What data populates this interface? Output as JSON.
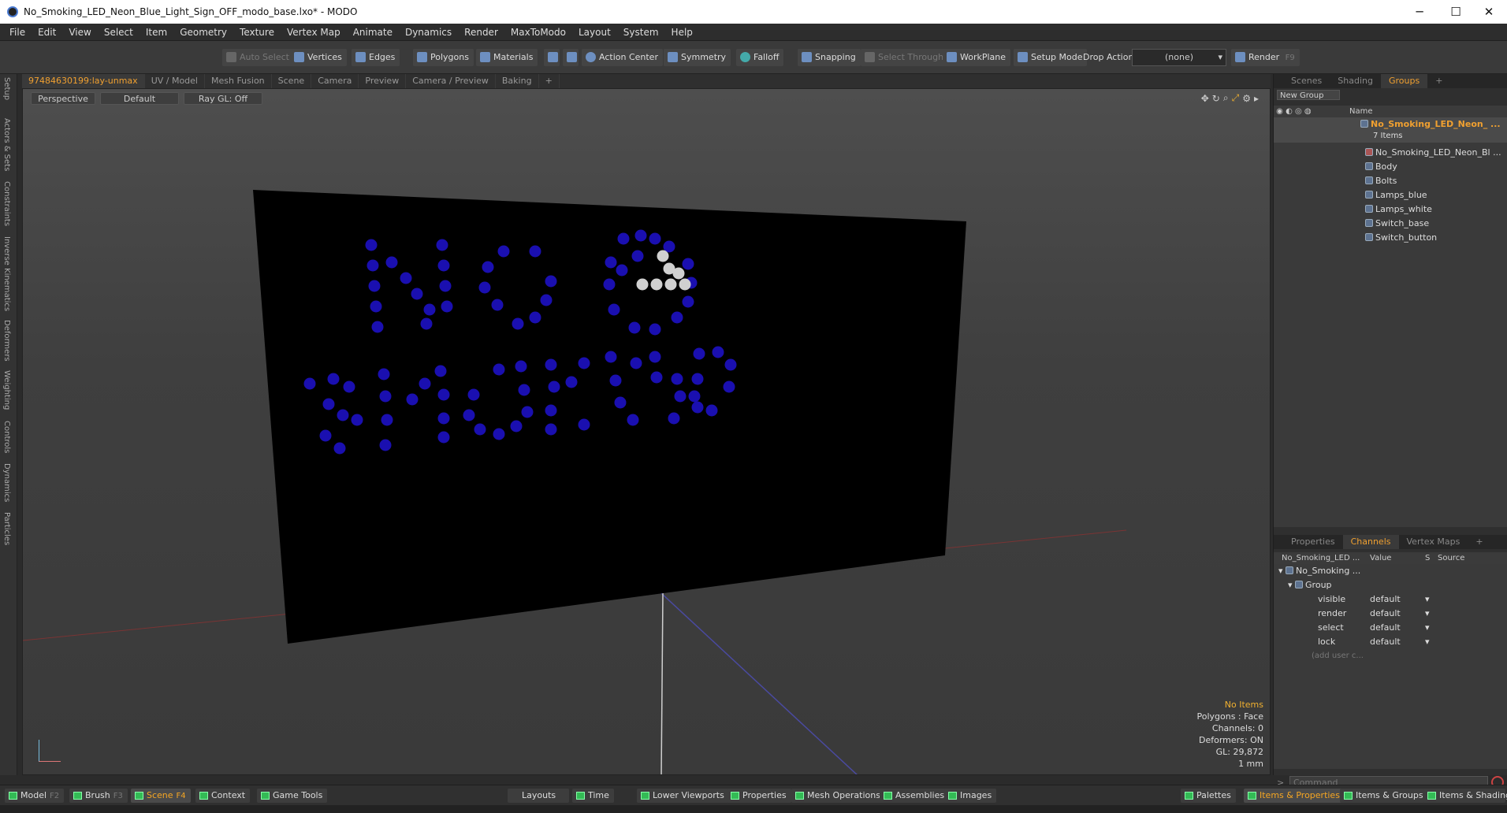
{
  "window": {
    "title": "No_Smoking_LED_Neon_Blue_Light_Sign_OFF_modo_base.lxo* - MODO",
    "minimize": "─",
    "maximize": "☐",
    "close": "✕"
  },
  "menu": [
    "File",
    "Edit",
    "View",
    "Select",
    "Item",
    "Geometry",
    "Texture",
    "Vertex Map",
    "Animate",
    "Dynamics",
    "Render",
    "MaxToModo",
    "Layout",
    "System",
    "Help"
  ],
  "toolbar": {
    "auto_select": "Auto Select",
    "vertices": "Vertices",
    "edges": "Edges",
    "polygons": "Polygons",
    "materials": "Materials",
    "action_center": "Action Center",
    "symmetry": "Symmetry",
    "falloff": "Falloff",
    "snapping": "Snapping",
    "select_through": "Select Through",
    "workplane": "WorkPlane",
    "setup_mode": "Setup Mode",
    "drop_action": "Drop Action",
    "drop_value": "(none)",
    "render": "Render",
    "render_key": "F9"
  },
  "left_tabs": [
    "Setup",
    "Actors & Sets",
    "Constraints",
    "Inverse Kinematics",
    "Deformers",
    "Weighting",
    "Controls",
    "Dynamics",
    "Particles"
  ],
  "viewport_tabs": [
    "97484630199:lay-unmax",
    "UV / Model",
    "Mesh Fusion",
    "Scene",
    "Camera",
    "Preview",
    "Camera / Preview",
    "Baking",
    "+"
  ],
  "viewport": {
    "view": "Perspective",
    "shading": "Default",
    "raygl": "Ray GL: Off",
    "status": [
      "No Items",
      "Polygons : Face",
      "Channels: 0",
      "Deformers: ON",
      "GL: 29,872",
      "1 mm"
    ]
  },
  "scene_panel": {
    "tabs": [
      "Scenes",
      "Shading",
      "Groups",
      "+"
    ],
    "new_group": "New Group",
    "col_name": "Name",
    "group_name": "No_Smoking_LED_Neon_ ...",
    "group_count": "7 Items",
    "items": [
      "No_Smoking_LED_Neon_Bl ...",
      "Body",
      "Bolts",
      "Lamps_blue",
      "Lamps_white",
      "Switch_base",
      "Switch_button"
    ]
  },
  "channels_panel": {
    "tabs": [
      "Properties",
      "Channels",
      "Vertex Maps",
      "+"
    ],
    "col_item": "No_Smoking_LED ...",
    "col_value": "Value",
    "col_s": "S",
    "col_source": "Source",
    "root": "No_Smoking ...",
    "group": "Group",
    "rows": [
      {
        "name": "visible",
        "value": "default"
      },
      {
        "name": "render",
        "value": "default"
      },
      {
        "name": "select",
        "value": "default"
      },
      {
        "name": "lock",
        "value": "default"
      }
    ],
    "add_user": "(add user c..."
  },
  "command_placeholder": "Command",
  "bottom": {
    "model": "Model",
    "model_key": "F2",
    "brush": "Brush",
    "brush_key": "F3",
    "scene": "Scene",
    "scene_key": "F4",
    "context": "Context",
    "game_tools": "Game Tools",
    "layouts": "Layouts",
    "time": "Time",
    "lower_viewports": "Lower Viewports",
    "properties": "Properties",
    "mesh_operations": "Mesh Operations",
    "assemblies": "Assemblies",
    "images": "Images",
    "palettes": "Palettes",
    "items_properties": "Items & Properties",
    "items_groups": "Items & Groups",
    "items_shading": "Items & Shading"
  },
  "colors": {
    "accent": "#f0a030",
    "led_blue": "#1a0fb0",
    "led_white": "#d0d0d0",
    "sign_board": "#000000"
  }
}
